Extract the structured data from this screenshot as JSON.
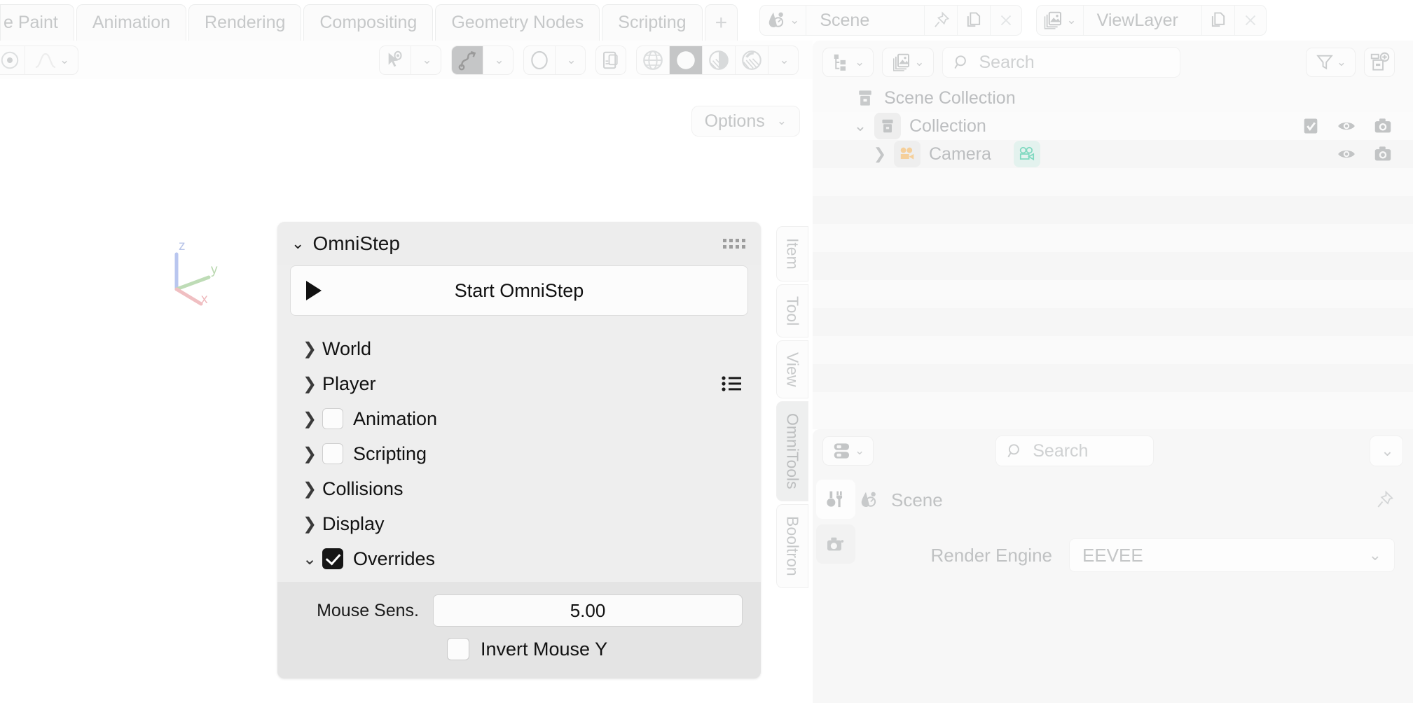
{
  "app": "blender",
  "topbar": {
    "workspace_tabs": [
      {
        "label": "e Paint",
        "active": false
      },
      {
        "label": "Animation",
        "active": false
      },
      {
        "label": "Rendering",
        "active": false
      },
      {
        "label": "Compositing",
        "active": false
      },
      {
        "label": "Geometry Nodes",
        "active": false
      },
      {
        "label": "Scripting",
        "active": false
      }
    ],
    "add_workspace_label": "+",
    "scene": {
      "icon": "scene-icon",
      "name": "Scene",
      "pin_icon": "pin-icon",
      "new_icon": "duplicate-icon",
      "unlink_icon": "close-icon"
    },
    "view_layer": {
      "icon": "view-layer-icon",
      "name": "ViewLayer",
      "new_icon": "duplicate-icon",
      "unlink_icon": "close-icon"
    }
  },
  "viewport_header": {
    "editor_type_icon": "editor-type-icon",
    "mode_icon": "object-mode-icon",
    "select_icon": "select-tool-icon",
    "snap_icon": "snap-magnet-icon",
    "proportional_icon": "proportional-edit-icon",
    "toggle_xray_icon": "xray-icon",
    "shading": [
      {
        "name": "wireframe",
        "active": false
      },
      {
        "name": "solid",
        "active": true
      },
      {
        "name": "material-preview",
        "active": false
      },
      {
        "name": "rendered",
        "active": false
      }
    ],
    "options_label": "Options"
  },
  "gizmo": {
    "axis_z": "z",
    "axis_y": "y",
    "axis_x": "x",
    "color_z": "#b9c6ef",
    "color_y": "#bedcb6",
    "color_x": "#f0bfc2"
  },
  "sidebar_tabs": [
    {
      "label": "Item",
      "active": false
    },
    {
      "label": "Tool",
      "active": false
    },
    {
      "label": "View",
      "active": false
    },
    {
      "label": "OmniTools",
      "active": true
    },
    {
      "label": "Booltron",
      "active": false
    }
  ],
  "omnistep_panel": {
    "title": "OmniStep",
    "expanded": true,
    "grip_icon": "drag-grip-icon",
    "start_button": {
      "label": "Start OmniStep",
      "icon": "play-icon"
    },
    "sections": [
      {
        "label": "World",
        "expanded": false,
        "has_checkbox": false,
        "checked": false,
        "has_preset": false
      },
      {
        "label": "Player",
        "expanded": false,
        "has_checkbox": false,
        "checked": false,
        "has_preset": true
      },
      {
        "label": "Animation",
        "expanded": false,
        "has_checkbox": true,
        "checked": false,
        "has_preset": false
      },
      {
        "label": "Scripting",
        "expanded": false,
        "has_checkbox": true,
        "checked": false,
        "has_preset": false
      },
      {
        "label": "Collisions",
        "expanded": false,
        "has_checkbox": false,
        "checked": false,
        "has_preset": false
      },
      {
        "label": "Display",
        "expanded": false,
        "has_checkbox": false,
        "checked": false,
        "has_preset": false
      },
      {
        "label": "Overrides",
        "expanded": true,
        "has_checkbox": true,
        "checked": true,
        "has_preset": false
      }
    ],
    "overrides": {
      "mouse_sens_label": "Mouse Sens.",
      "mouse_sens_value": "5.00",
      "invert_mouse_y_label": "Invert Mouse Y",
      "invert_mouse_y_checked": false
    }
  },
  "outliner": {
    "display_mode_icon": "outliner-display-mode-icon",
    "filter_id_icon": "id-type-filter-icon",
    "search_placeholder": "Search",
    "filter_icon": "funnel-icon",
    "new_collection_icon": "new-collection-icon",
    "rows": [
      {
        "label": "Scene Collection",
        "icon": "scene-collection-icon",
        "indent": 0,
        "arrow": "",
        "toggles": []
      },
      {
        "label": "Collection",
        "icon": "collection-icon",
        "indent": 1,
        "arrow": "expanded",
        "toggles": [
          "checkbox-checked-icon",
          "eye-icon",
          "camera-icon"
        ]
      },
      {
        "label": "Camera",
        "icon": "camera-object-icon",
        "indent": 2,
        "arrow": "collapsed",
        "toggles": [
          "eye-icon",
          "camera-icon"
        ],
        "data_icon": "camera-data-icon",
        "icon_color": "#f5cf9a",
        "data_icon_color": "#7fd9c0"
      }
    ]
  },
  "properties": {
    "editor_icon": "properties-editor-icon",
    "search_placeholder": "Search",
    "caret_icon": "chevron-down-icon",
    "tabs": [
      {
        "name": "tool",
        "icon": "tool-icon",
        "active": true
      },
      {
        "name": "render",
        "icon": "render-camera-icon",
        "active": false
      }
    ],
    "breadcrumb": {
      "icon": "scene-icon",
      "label": "Scene",
      "pin_icon": "pin-icon"
    },
    "render_engine_label": "Render Engine",
    "render_engine_value": "EEVEE"
  },
  "colors": {
    "panel_bg": "#eeeeee",
    "sub_panel_bg": "#e4e4e4",
    "outliner_bg": "#fafafa",
    "properties_bg": "#f7f7f7",
    "text_dark": "#111111",
    "text_muted": "#c2c4c5",
    "accent_orange": "#f5cf9a",
    "accent_teal": "#7fd9c0"
  }
}
